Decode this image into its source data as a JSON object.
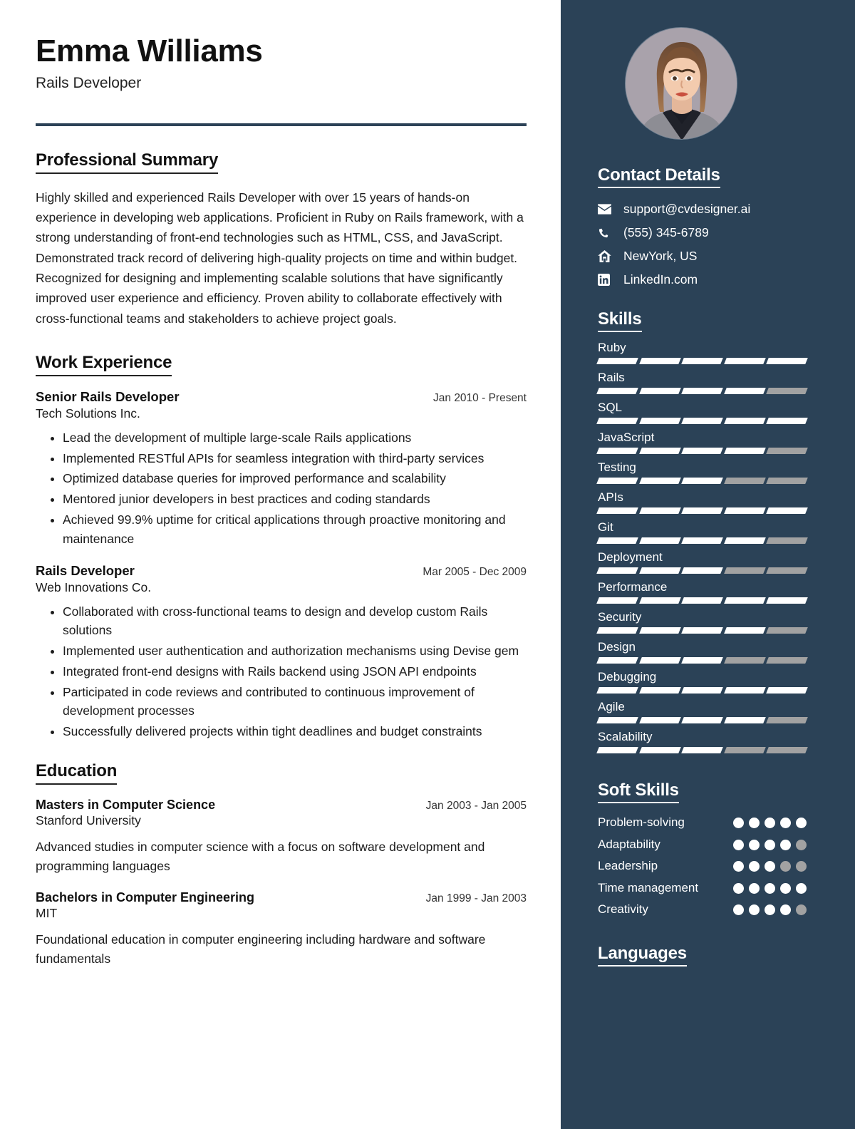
{
  "header": {
    "name": "Emma Williams",
    "job_title": "Rails Developer"
  },
  "sections": {
    "summary_heading": "Professional Summary",
    "summary_text": "Highly skilled and experienced Rails Developer with over 15 years of hands-on experience in developing web applications. Proficient in Ruby on Rails framework, with a strong understanding of front-end technologies such as HTML, CSS, and JavaScript. Demonstrated track record of delivering high-quality projects on time and within budget. Recognized for designing and implementing scalable solutions that have significantly improved user experience and efficiency. Proven ability to collaborate effectively with cross-functional teams and stakeholders to achieve project goals.",
    "work_heading": "Work Experience",
    "education_heading": "Education"
  },
  "work_experience": [
    {
      "role": "Senior Rails Developer",
      "date": "Jan 2010 - Present",
      "company": "Tech Solutions Inc.",
      "bullets": [
        "Lead the development of multiple large-scale Rails applications",
        "Implemented RESTful APIs for seamless integration with third-party services",
        "Optimized database queries for improved performance and scalability",
        "Mentored junior developers in best practices and coding standards",
        "Achieved 99.9% uptime for critical applications through proactive monitoring and maintenance"
      ]
    },
    {
      "role": "Rails Developer",
      "date": "Mar 2005 - Dec 2009",
      "company": "Web Innovations Co.",
      "bullets": [
        "Collaborated with cross-functional teams to design and develop custom Rails solutions",
        "Implemented user authentication and authorization mechanisms using Devise gem",
        "Integrated front-end designs with Rails backend using JSON API endpoints",
        "Participated in code reviews and contributed to continuous improvement of development processes",
        "Successfully delivered projects within tight deadlines and budget constraints"
      ]
    }
  ],
  "education": [
    {
      "degree": "Masters in Computer Science",
      "date": "Jan 2003 - Jan 2005",
      "school": "Stanford University",
      "description": "Advanced studies in computer science with a focus on software development and programming languages"
    },
    {
      "degree": "Bachelors in Computer Engineering",
      "date": "Jan 1999 - Jan 2003",
      "school": "MIT",
      "description": "Foundational education in computer engineering including hardware and software fundamentals"
    }
  ],
  "sidebar": {
    "contact_heading": "Contact Details",
    "contact": [
      {
        "icon": "envelope-icon",
        "value": "support@cvdesigner.ai"
      },
      {
        "icon": "phone-icon",
        "value": "(555) 345-6789"
      },
      {
        "icon": "home-icon",
        "value": "NewYork, US"
      },
      {
        "icon": "linkedin-icon",
        "value": "LinkedIn.com"
      }
    ],
    "skills_heading": "Skills",
    "skills": [
      {
        "name": "Ruby",
        "level": 5,
        "max": 5
      },
      {
        "name": "Rails",
        "level": 4,
        "max": 5
      },
      {
        "name": "SQL",
        "level": 5,
        "max": 5
      },
      {
        "name": "JavaScript",
        "level": 4,
        "max": 5
      },
      {
        "name": "Testing",
        "level": 3,
        "max": 5
      },
      {
        "name": "APIs",
        "level": 5,
        "max": 5
      },
      {
        "name": "Git",
        "level": 4,
        "max": 5
      },
      {
        "name": "Deployment",
        "level": 3,
        "max": 5
      },
      {
        "name": "Performance",
        "level": 5,
        "max": 5
      },
      {
        "name": "Security",
        "level": 4,
        "max": 5
      },
      {
        "name": "Design",
        "level": 3,
        "max": 5
      },
      {
        "name": "Debugging",
        "level": 5,
        "max": 5
      },
      {
        "name": "Agile",
        "level": 4,
        "max": 5
      },
      {
        "name": "Scalability",
        "level": 3,
        "max": 5
      }
    ],
    "soft_skills_heading": "Soft Skills",
    "soft_skills": [
      {
        "name": "Problem-solving",
        "level": 5,
        "max": 5
      },
      {
        "name": "Adaptability",
        "level": 4,
        "max": 5
      },
      {
        "name": "Leadership",
        "level": 3,
        "max": 5
      },
      {
        "name": "Time management",
        "level": 5,
        "max": 5
      },
      {
        "name": "Creativity",
        "level": 4,
        "max": 5
      }
    ],
    "languages_heading": "Languages"
  },
  "colors": {
    "sidebar_bg": "#2b4257",
    "divider": "#2c4257",
    "bar_on": "#ffffff",
    "bar_off": "#a2a2a2",
    "text_dark": "#1c1c1c"
  }
}
